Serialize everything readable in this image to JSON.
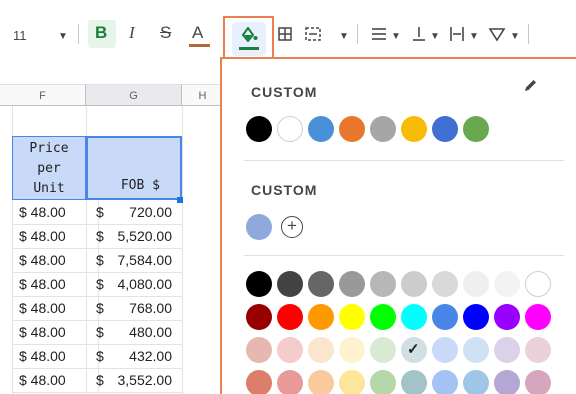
{
  "toolbar": {
    "font_size": "11",
    "bold_label": "B",
    "italic_label": "I",
    "strike_label": "S",
    "text_color_label": "A",
    "text_color_bar": "#b06a3b",
    "fill_color_line": "#188038",
    "icons": [
      "caret-down-icon",
      "bold-icon",
      "italic-icon",
      "strikethrough-icon",
      "text-color-icon",
      "fill-color-icon",
      "borders-icon",
      "merge-cells-icon",
      "horizontal-align-icon",
      "vertical-align-icon",
      "text-wrap-icon",
      "text-rotation-icon"
    ]
  },
  "sheet": {
    "columns": [
      "F",
      "G",
      "H"
    ],
    "header_f_lines": [
      "Price",
      "per",
      "Unit"
    ],
    "header_g": "FOB $",
    "selection_color": "#4a86e8",
    "rows": [
      {
        "price": "$ 48.00",
        "fob_symbol": "$",
        "fob_amount": "720.00"
      },
      {
        "price": "$ 48.00",
        "fob_symbol": "$",
        "fob_amount": "5,520.00"
      },
      {
        "price": "$ 48.00",
        "fob_symbol": "$",
        "fob_amount": "7,584.00"
      },
      {
        "price": "$ 48.00",
        "fob_symbol": "$",
        "fob_amount": "4,080.00"
      },
      {
        "price": "$ 48.00",
        "fob_symbol": "$",
        "fob_amount": "768.00"
      },
      {
        "price": "$ 48.00",
        "fob_symbol": "$",
        "fob_amount": "480.00"
      },
      {
        "price": "$ 48.00",
        "fob_symbol": "$",
        "fob_amount": "432.00"
      },
      {
        "price": "$ 48.00",
        "fob_symbol": "$",
        "fob_amount": "3,552.00"
      }
    ]
  },
  "palette": {
    "custom_title_1": "CUSTOM",
    "custom_title_2": "CUSTOM",
    "custom_colors_1": [
      "#000000",
      "#ffffff",
      "#4a90d9",
      "#e8762b",
      "#a6a6a6",
      "#f8bc08",
      "#3f6fd1",
      "#6aa84f"
    ],
    "custom_colors_2": [
      "#8fa9dc"
    ],
    "add_symbol": "+",
    "grid": [
      [
        "#000000",
        "#434343",
        "#666666",
        "#999999",
        "#b7b7b7",
        "#cccccc",
        "#d9d9d9",
        "#efefef",
        "#f3f3f3",
        "#ffffff"
      ],
      [
        "#980000",
        "#ff0000",
        "#ff9900",
        "#ffff00",
        "#00ff00",
        "#00ffff",
        "#4a86e8",
        "#0000ff",
        "#9900ff",
        "#ff00ff"
      ],
      [
        "#e6b8af",
        "#f4cccc",
        "#fce5cd",
        "#fff2cc",
        "#d9ead3",
        "#d0e0e3",
        "#c9daf8",
        "#cfe2f3",
        "#d9d2e9",
        "#ead1dc"
      ],
      [
        "#dd7e6b",
        "#ea9999",
        "#f9cb9c",
        "#ffe599",
        "#b6d7a8",
        "#a2c4c9",
        "#a4c2f4",
        "#9fc5e8",
        "#b4a7d6",
        "#d5a6bd"
      ]
    ],
    "selected_row": 2,
    "selected_col": 5,
    "check_symbol": "✓"
  }
}
